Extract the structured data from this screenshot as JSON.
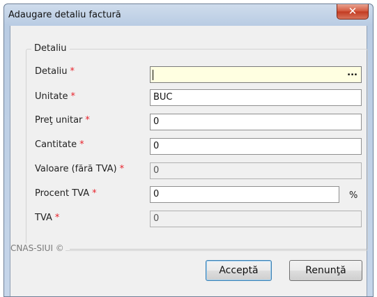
{
  "window": {
    "title": "Adaugare detaliu factură",
    "close_glyph": "✕"
  },
  "group": {
    "legend": "Detaliu"
  },
  "required_marker": "*",
  "fields": [
    {
      "label": "Detaliu",
      "value": "",
      "browse": "..."
    },
    {
      "label": "Unitate",
      "value": "BUC"
    },
    {
      "label": "Preţ unitar",
      "value": "0"
    },
    {
      "label": "Cantitate",
      "value": "0"
    },
    {
      "label": "Valoare (fără TVA)",
      "value": "0"
    },
    {
      "label": "Procent TVA",
      "value": "0",
      "suffix": "%"
    },
    {
      "label": "TVA",
      "value": "0"
    }
  ],
  "footer": {
    "text": "CNAS-SIUI ©"
  },
  "buttons": {
    "accept": "Acceptă",
    "cancel": "Renunţă"
  }
}
